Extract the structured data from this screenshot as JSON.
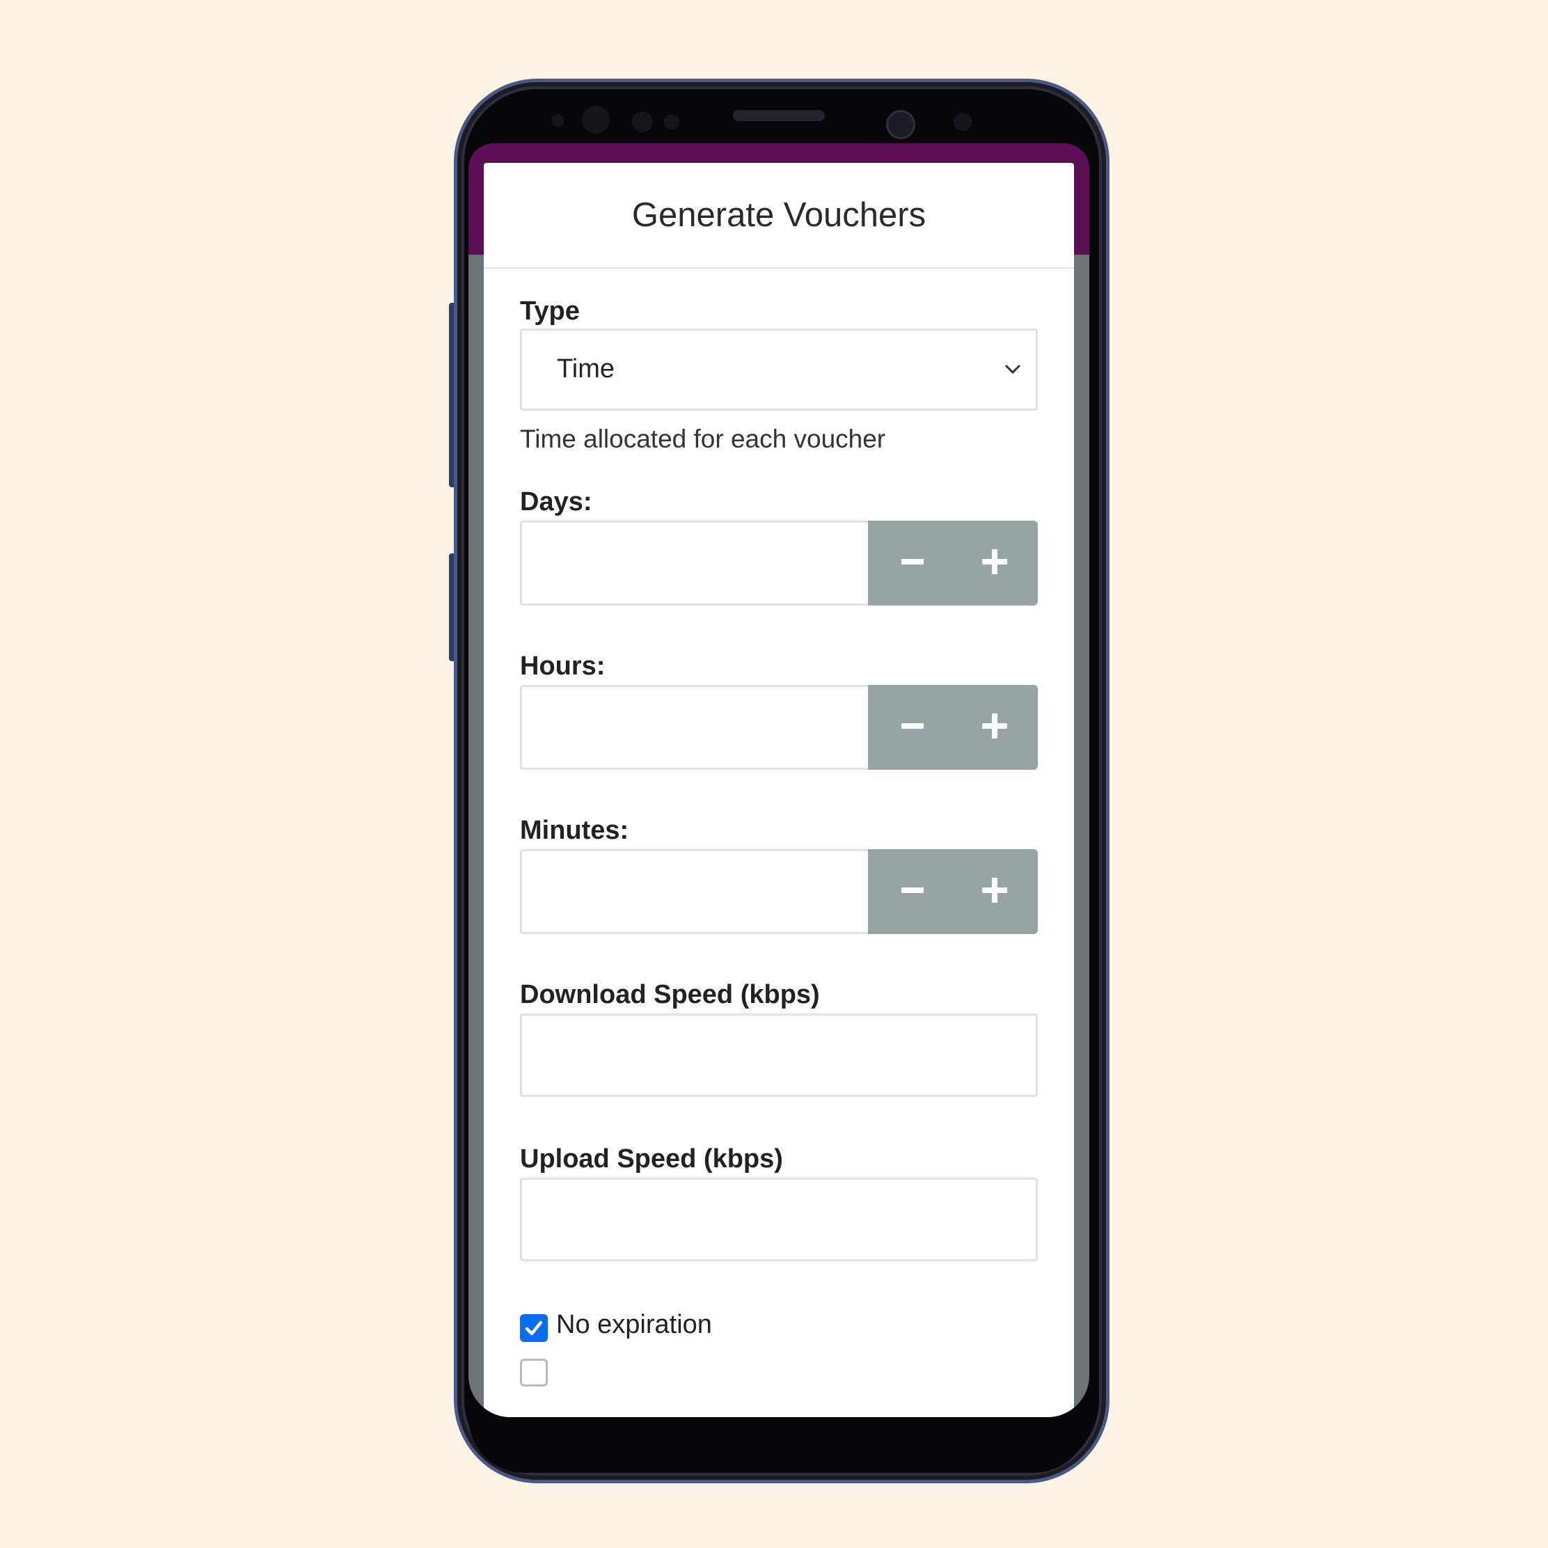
{
  "modal": {
    "title": "Generate Vouchers"
  },
  "form": {
    "type_label": "Type",
    "type_value": "Time",
    "time_help": "Time allocated for each voucher",
    "days_label": "Days:",
    "hours_label": "Hours:",
    "minutes_label": "Minutes:",
    "download_label": "Download Speed (kbps)",
    "upload_label": "Upload Speed (kbps)",
    "no_expiration_label": "No expiration",
    "no_expiration_checked": true
  },
  "icons": {
    "type_dropdown": "chevron-down-icon",
    "decrement": "minus-icon",
    "increment": "plus-icon",
    "check": "checkmark-icon"
  },
  "colors": {
    "page_background": "#fdf3e4",
    "header_accent": "#5c0f54",
    "stepper_buttons": "#95a5a5",
    "checkbox_checked": "#0a6cf0"
  }
}
